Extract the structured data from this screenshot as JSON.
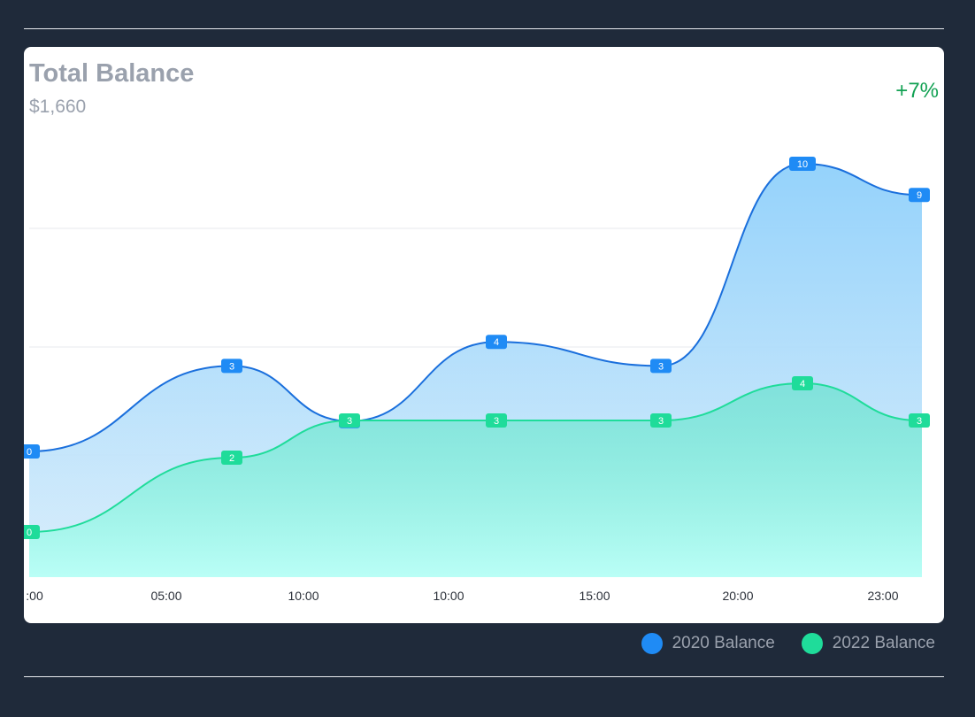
{
  "header": {
    "title": "Total Balance",
    "amount": "$1,660",
    "change": "+7%"
  },
  "colors": {
    "series_a": "#1f8bf5",
    "series_a_line": "#1a6fdc",
    "series_b": "#1fdc9a",
    "change": "#12a153"
  },
  "chart_data": {
    "type": "area",
    "x": [
      ":00",
      "05:00",
      "10:00",
      "10:00",
      "15:00",
      "20:00",
      "23:00"
    ],
    "series": [
      {
        "name": "2020 Balance",
        "values": [
          0,
          3,
          1,
          4,
          3,
          10,
          9
        ]
      },
      {
        "name": "2022 Balance",
        "values": [
          0,
          2,
          3,
          3,
          3,
          4,
          3
        ]
      }
    ],
    "legend": "bottom-right",
    "grid": true
  }
}
